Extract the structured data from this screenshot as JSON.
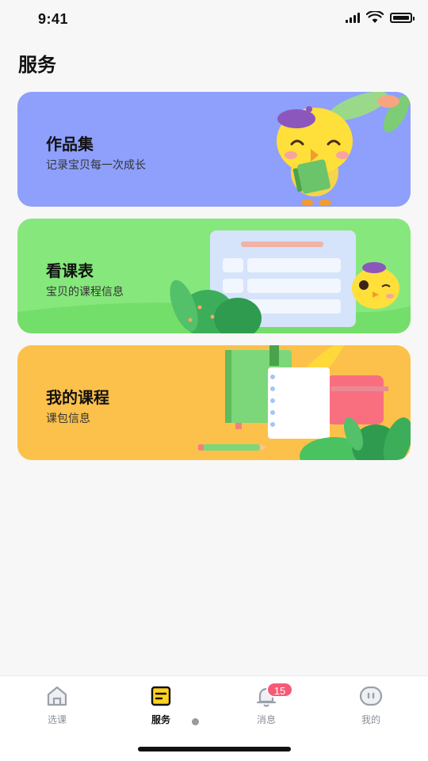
{
  "status_bar": {
    "time": "9:41"
  },
  "page": {
    "title": "服务"
  },
  "cards": [
    {
      "title": "作品集",
      "subtitle": "记录宝贝每一次成长",
      "bg_color": "#8ea0fb",
      "illustration": "chick-holding-book"
    },
    {
      "title": "看课表",
      "subtitle": "宝贝的课程信息",
      "bg_color": "#86e87c",
      "illustration": "schedule-board-with-chick"
    },
    {
      "title": "我的课程",
      "subtitle": "课包信息",
      "bg_color": "#fcc14b",
      "illustration": "books-and-notebook"
    }
  ],
  "tab_bar": {
    "active_index": 1,
    "items": [
      {
        "label": "选课",
        "icon": "house-icon"
      },
      {
        "label": "服务",
        "icon": "document-icon"
      },
      {
        "label": "消息",
        "icon": "bell-icon",
        "badge": "15"
      },
      {
        "label": "我的",
        "icon": "profile-face-icon"
      }
    ]
  },
  "colors": {
    "accent": "#ffd21f",
    "badge": "#f55b76",
    "inactive_tab": "#8a8f99"
  }
}
